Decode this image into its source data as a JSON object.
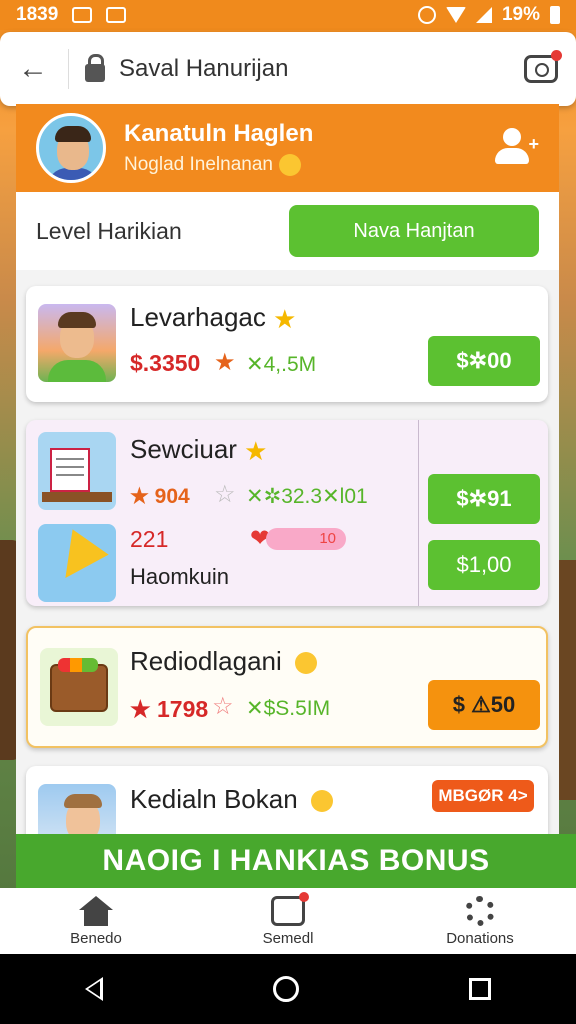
{
  "status_bar": {
    "time": "1839",
    "battery": "19%"
  },
  "url_bar": {
    "title": "Saval Hanurijan"
  },
  "profile": {
    "name": "Kanatuln Haglen",
    "subtitle": "Noglad Inelnanan"
  },
  "level": {
    "label": "Level Harikian",
    "button": "Nava Hanjtan"
  },
  "cards": [
    {
      "title": "Levarhagac",
      "price": "$.3350",
      "stat": "✕4,.5M",
      "buy": "$✲00"
    },
    {
      "title": "Sewciuar",
      "stat_a": "★ 904",
      "stat_b": "✕✲32.3✕l01",
      "buy_a": "$✲91",
      "count": "221",
      "pill": "10",
      "subtitle": "Haomkuin",
      "buy_b": "$1,00"
    },
    {
      "title": "Rediodlagani",
      "price": "★ 1798",
      "stat": "✕$S.5IM",
      "buy": "$ ⚠50"
    },
    {
      "title": "Kedialn Bokan",
      "badge": "MBGØR 4>"
    }
  ],
  "bonus": {
    "text": "NAOIG I HANKIAS BONUS"
  },
  "tabs": [
    {
      "label": "Benedo"
    },
    {
      "label": "Semedl"
    },
    {
      "label": "Donations"
    }
  ],
  "colors": {
    "accent_orange": "#f28a1e",
    "accent_green": "#5cc131",
    "alert_red": "#d62828"
  }
}
